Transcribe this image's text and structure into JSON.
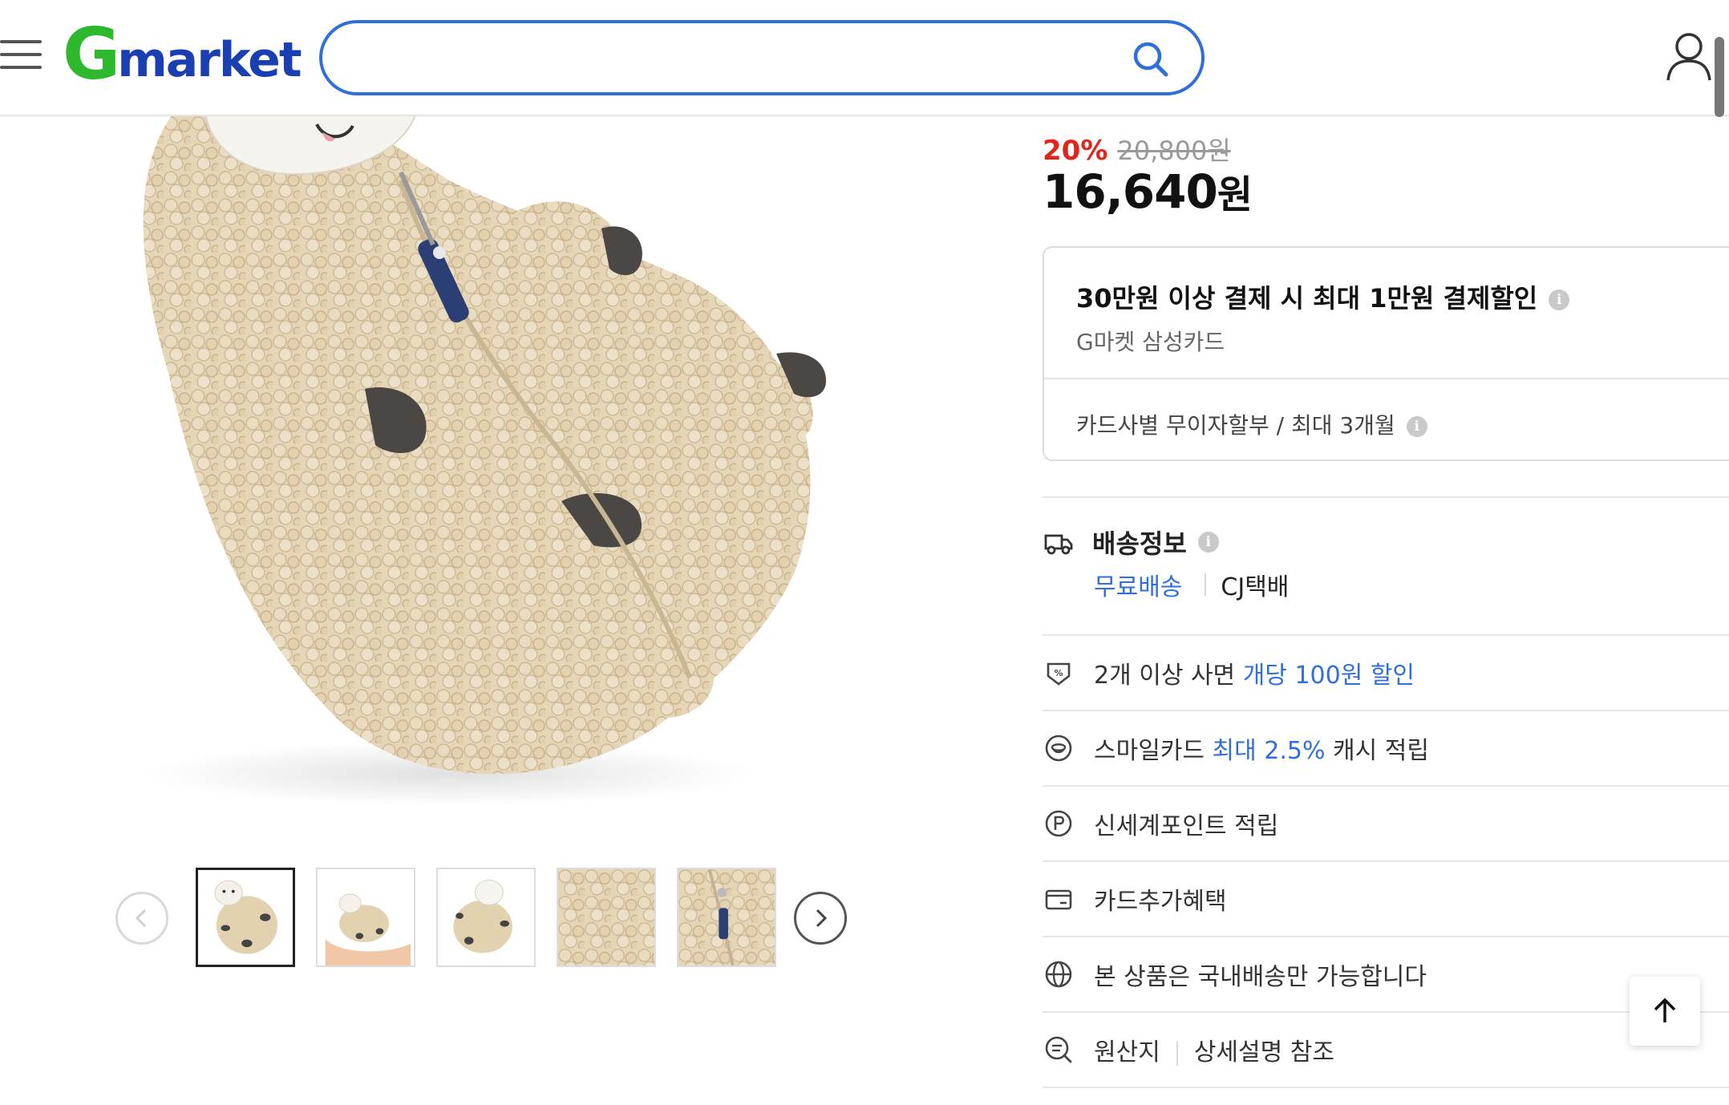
{
  "header": {
    "logo_g": "G",
    "logo_rest": "market",
    "search": {
      "placeholder": "",
      "value": ""
    }
  },
  "thumbnails": {
    "count": 5,
    "selected_index": 0,
    "items": [
      "sheep-plush-front",
      "sheep-plush-in-hands",
      "sheep-plush-side",
      "fleece-texture-closeup",
      "zipper-closeup"
    ]
  },
  "price": {
    "discount": "20%",
    "original": "20,800원",
    "current_number": "16,640",
    "current_unit": "원"
  },
  "promo": {
    "title": "30만원 이상 결제 시 최대 1만원 결제할인",
    "subtitle": "G마켓 삼성카드",
    "installment": "카드사별 무이자할부 / 최대 3개월"
  },
  "shipping": {
    "title": "배송정보",
    "free": "무료배송",
    "courier": "CJ택배"
  },
  "benefits": {
    "multi_prefix": "2개 이상 사면 ",
    "multi_highlight": "개당 100원 할인",
    "smile_prefix": "스마일카드 ",
    "smile_highlight": "최대 2.5%",
    "smile_suffix": " 캐시 적립",
    "shinsegae": "신세계포인트 적립",
    "card_extra": "카드추가혜택",
    "domestic": "본 상품은 국내배송만 가능합니다",
    "origin_label": "원산지",
    "origin_value": "상세설명 참조"
  },
  "icons": {
    "menu": "menu-icon",
    "search": "search-icon",
    "user": "user-icon",
    "truck": "truck-icon",
    "discount_tag": "discount-tag-icon",
    "smile": "smile-card-icon",
    "point": "point-p-icon",
    "card": "card-icon",
    "globe": "globe-icon",
    "origin": "origin-search-icon",
    "arrow_up": "arrow-up-icon"
  },
  "colors": {
    "brand_green": "#2eb82e",
    "brand_blue": "#1a3fb3",
    "search_border": "#2f6fdc",
    "discount_red": "#e1251b",
    "highlight_blue": "#2f6fdc"
  }
}
